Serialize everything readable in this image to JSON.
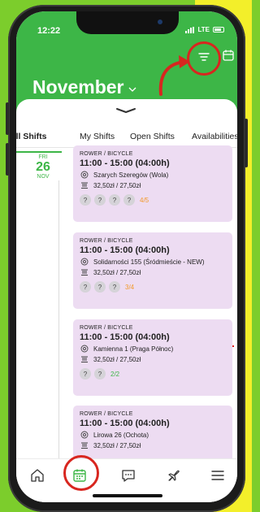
{
  "status": {
    "time": "12:22",
    "network": "LTE"
  },
  "header": {
    "month": "November",
    "icons": [
      "chevron-down-icon",
      "filter-icon",
      "calendar-icon"
    ]
  },
  "tabs": [
    {
      "label": "All Shifts",
      "active": true
    },
    {
      "label": "My Shifts",
      "active": false
    },
    {
      "label": "Open Shifts",
      "active": false
    },
    {
      "label": "Availabilities",
      "active": false
    }
  ],
  "day": {
    "weekday": "FRI",
    "date": "26",
    "month": "NOV"
  },
  "shifts": [
    {
      "category": "ROWER / BICYCLE",
      "time": "11:00 - 15:00 (04:00h)",
      "location": "Szarych Szeregów (Wola)",
      "rate": "32,50zł / 27,50zł",
      "slots": [
        "?",
        "?",
        "?",
        "?"
      ],
      "count": "4/5"
    },
    {
      "category": "ROWER / BICYCLE",
      "time": "11:00 - 15:00 (04:00h)",
      "location": "Solidarności 155 (Śródmieście - NEW)",
      "rate": "32,50zł / 27,50zł",
      "slots": [
        "?",
        "?",
        "?"
      ],
      "count": "3/4"
    },
    {
      "category": "ROWER / BICYCLE",
      "time": "11:00 - 15:00 (04:00h)",
      "location": "Kamienna 1 (Praga Północ)",
      "rate": "32,50zł / 27,50zł",
      "slots": [
        "?",
        "?"
      ],
      "count": "2/2"
    },
    {
      "category": "ROWER / BICYCLE",
      "time": "11:00 - 15:00 (04:00h)",
      "location": "Lirowa 26 (Ochota)",
      "rate": "32,50zł / 27,50zł",
      "slots": [],
      "count": ""
    }
  ],
  "nav": [
    "home-icon",
    "calendar-icon",
    "chat-icon",
    "plane-icon",
    "menu-icon"
  ],
  "colors": {
    "brand_green": "#3db647",
    "card_bg": "#eddcf2",
    "count_orange": "#f29a2b",
    "annotation_red": "#d8261f"
  }
}
